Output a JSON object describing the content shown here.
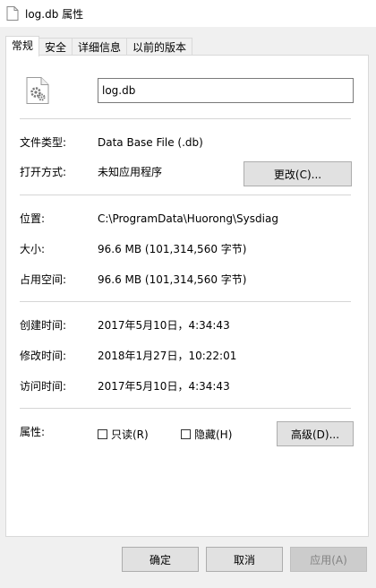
{
  "window": {
    "title": "log.db 属性"
  },
  "tabs": [
    {
      "label": "常规",
      "active": true
    },
    {
      "label": "安全"
    },
    {
      "label": "详细信息"
    },
    {
      "label": "以前的版本"
    }
  ],
  "general": {
    "file_name": "log.db",
    "file_type_label": "文件类型:",
    "file_type_value": "Data Base File (.db)",
    "open_with_label": "打开方式:",
    "open_with_value": "未知应用程序",
    "change_button": "更改(C)...",
    "location_label": "位置:",
    "location_value": "C:\\ProgramData\\Huorong\\Sysdiag",
    "size_label": "大小:",
    "size_value": "96.6 MB (101,314,560 字节)",
    "size_on_disk_label": "占用空间:",
    "size_on_disk_value": "96.6 MB (101,314,560 字节)",
    "created_label": "创建时间:",
    "created_value": "2017年5月10日，4:34:43",
    "modified_label": "修改时间:",
    "modified_value": "2018年1月27日，10:22:01",
    "accessed_label": "访问时间:",
    "accessed_value": "2017年5月10日，4:34:43",
    "attributes_label": "属性:",
    "readonly_label": "只读(R)",
    "hidden_label": "隐藏(H)",
    "advanced_button": "高级(D)..."
  },
  "footer": {
    "ok": "确定",
    "cancel": "取消",
    "apply": "应用(A)"
  }
}
